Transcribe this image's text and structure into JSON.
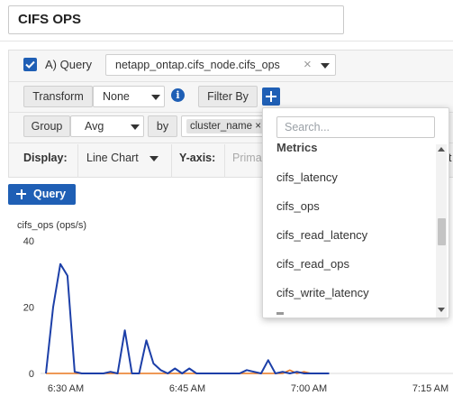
{
  "dashboard": {
    "title": "CIFS OPS"
  },
  "query": {
    "label": "A) Query",
    "metric": "netapp_ontap.cifs_node.cifs_ops",
    "clear_glyph": "×",
    "transform_label": "Transform",
    "transform_value": "None",
    "info_glyph": "i",
    "filter_by_label": "Filter By",
    "group_label": "Group",
    "group_value": "Avg",
    "by_label": "by",
    "group_tag": "cluster_name",
    "group_tag_remove": "×",
    "display_label": "Display:",
    "display_value": "Line Chart",
    "yaxis_label": "Y-axis:",
    "yaxis_value": "Prima",
    "cut_off_text": "t"
  },
  "add_query": {
    "label": "Query"
  },
  "dropdown": {
    "search_placeholder": "Search...",
    "section_header": "Metrics",
    "items": [
      "cifs_latency",
      "cifs_ops",
      "cifs_read_latency",
      "cifs_read_ops",
      "cifs_write_latency"
    ]
  },
  "chart_data": {
    "type": "line",
    "ylabel": "cifs_ops (ops/s)",
    "ylim": [
      0,
      40
    ],
    "yticks": [
      "40",
      "20",
      "0"
    ],
    "xlim_minutes": [
      0,
      32.5
    ],
    "xticks": [
      {
        "label": "6:30 AM",
        "minute": 0
      },
      {
        "label": "6:45 AM",
        "minute": 15
      },
      {
        "label": "7:00 AM",
        "minute": 30
      },
      {
        "label": "7:15 AM",
        "minute": 45
      }
    ],
    "grid": false,
    "series": [
      {
        "color": "#1c3fa8",
        "points": [
          [
            -2.44,
            0
          ],
          [
            -1.55,
            20
          ],
          [
            -0.67,
            33
          ],
          [
            0.21,
            29.5
          ],
          [
            1.1,
            0.5
          ],
          [
            1.98,
            0
          ],
          [
            4.64,
            0
          ],
          [
            5.52,
            0.5
          ],
          [
            6.4,
            0
          ],
          [
            7.29,
            13
          ],
          [
            8.17,
            0
          ],
          [
            9.06,
            0
          ],
          [
            9.94,
            10
          ],
          [
            10.82,
            3
          ],
          [
            11.71,
            1
          ],
          [
            12.59,
            0
          ],
          [
            13.48,
            1.5
          ],
          [
            14.36,
            0
          ],
          [
            15.24,
            1.5
          ],
          [
            16.13,
            0
          ],
          [
            21.45,
            0
          ],
          [
            22.33,
            1
          ],
          [
            23.22,
            0.5
          ],
          [
            24.1,
            0
          ],
          [
            24.98,
            4
          ],
          [
            25.87,
            0
          ],
          [
            26.75,
            0.5
          ],
          [
            27.64,
            0
          ],
          [
            28.52,
            0.5
          ],
          [
            29.41,
            0
          ],
          [
            32.5,
            0
          ]
        ]
      },
      {
        "color": "#e8761e",
        "points": [
          [
            -2.44,
            0
          ],
          [
            26.75,
            0
          ],
          [
            27.64,
            1
          ],
          [
            28.52,
            0
          ],
          [
            29.4,
            0.5
          ],
          [
            30.28,
            0
          ],
          [
            32.5,
            0
          ]
        ]
      }
    ]
  }
}
